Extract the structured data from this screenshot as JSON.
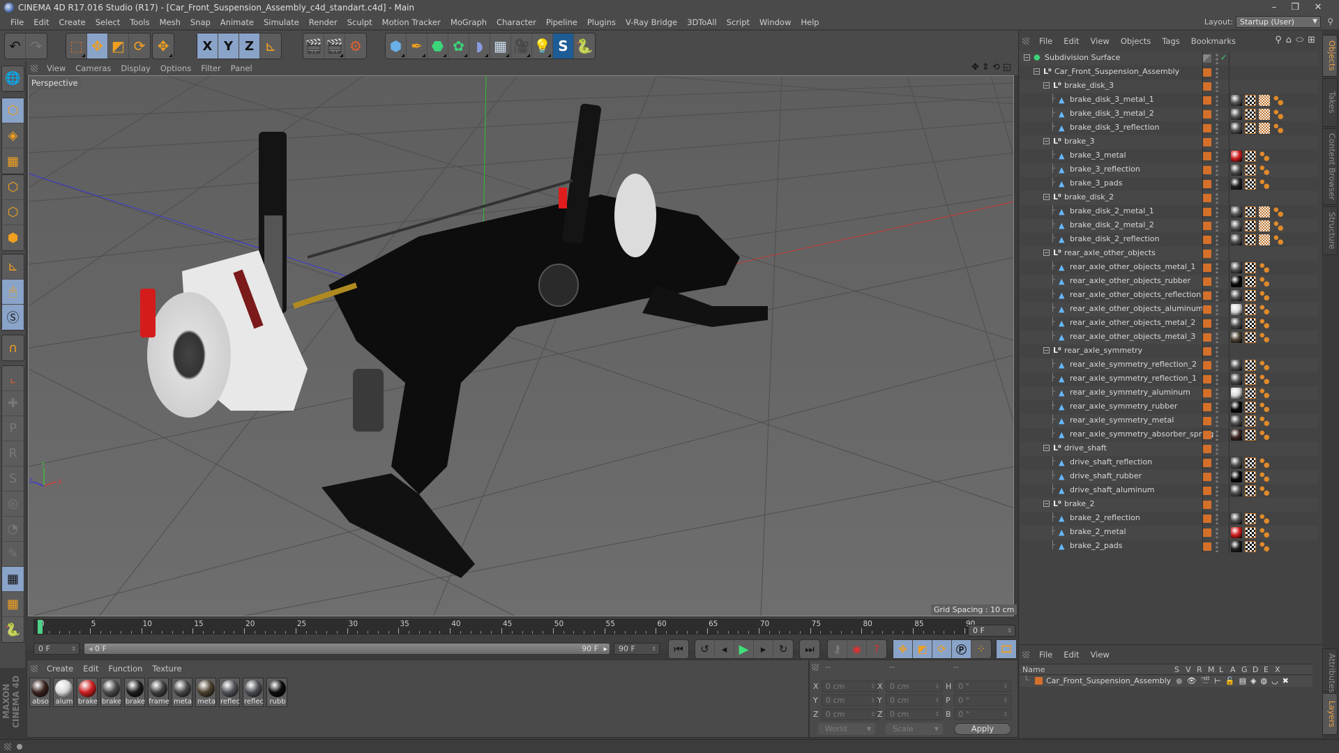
{
  "window": {
    "title": "CINEMA 4D R17.016 Studio (R17) - [Car_Front_Suspension_Assembly_c4d_standart.c4d] - Main",
    "controls": {
      "minimize": "–",
      "restore": "❐",
      "close": "✕"
    }
  },
  "menubar": [
    "File",
    "Edit",
    "Create",
    "Select",
    "Tools",
    "Mesh",
    "Snap",
    "Animate",
    "Simulate",
    "Render",
    "Sculpt",
    "Motion Tracker",
    "MoGraph",
    "Character",
    "Pipeline",
    "Plugins",
    "V-Ray Bridge",
    "3DToAll",
    "Script",
    "Window",
    "Help"
  ],
  "layout": {
    "label": "Layout:",
    "value": "Startup (User)"
  },
  "toolbar": {
    "undo": "undo-icon",
    "redo": "redo-icon",
    "tools": [
      "live-selection",
      "move",
      "scale",
      "rotate",
      "recent-tool"
    ],
    "axes": [
      "X",
      "Y",
      "Z"
    ],
    "coord_system": "world-coordinates-icon",
    "render": [
      "render-view",
      "render-to-picture-viewer",
      "render-settings"
    ],
    "objects": [
      "cube",
      "pen",
      "subdivision",
      "cloner",
      "deformer",
      "floor",
      "camera",
      "light",
      "vray",
      "python"
    ]
  },
  "viewport": {
    "menu": [
      "View",
      "Cameras",
      "Display",
      "Options",
      "Filter",
      "Panel"
    ],
    "camera_label": "Perspective",
    "grid_spacing": "Grid Spacing : 10 cm",
    "axis_labels": {
      "x": "X",
      "y": "Y",
      "z": "Z"
    }
  },
  "timeline": {
    "ticks": [
      0,
      5,
      10,
      15,
      20,
      25,
      30,
      35,
      40,
      45,
      50,
      55,
      60,
      65,
      70,
      75,
      80,
      85,
      90
    ],
    "current_frame": "0 F",
    "start_field": "0 F",
    "range_start": "0 F",
    "range_end": "90 F",
    "end_field": "90 F",
    "progress_fraction": 0
  },
  "material_panel": {
    "menu": [
      "Create",
      "Edit",
      "Function",
      "Texture"
    ],
    "materials": [
      {
        "label": "abso",
        "color": "#3a2420"
      },
      {
        "label": "alum",
        "color": "#d8d8d8"
      },
      {
        "label": "brake",
        "color": "#cc2020"
      },
      {
        "label": "brake",
        "color": "#4a4a4a"
      },
      {
        "label": "brake",
        "color": "#1e1e1e"
      },
      {
        "label": "frame",
        "color": "#3f3f3f"
      },
      {
        "label": "meta",
        "color": "#474747"
      },
      {
        "label": "meta",
        "color": "#4a3f2e"
      },
      {
        "label": "reflec",
        "color": "#505258"
      },
      {
        "label": "reflec",
        "color": "#4c4e54"
      },
      {
        "label": "rubb",
        "color": "#0c0c0c"
      }
    ],
    "branding": "MAXON CINEMA 4D"
  },
  "coordinates": {
    "headers": [
      "--",
      "--",
      "--"
    ],
    "rows": [
      {
        "l1": "X",
        "v1": "0 cm",
        "l2": "X",
        "v2": "0 cm",
        "l3": "H",
        "v3": "0 °"
      },
      {
        "l1": "Y",
        "v1": "0 cm",
        "l2": "Y",
        "v2": "0 cm",
        "l3": "P",
        "v3": "0 °"
      },
      {
        "l1": "Z",
        "v1": "0 cm",
        "l2": "Z",
        "v2": "0 cm",
        "l3": "B",
        "v3": "0 °"
      }
    ],
    "mode_dropdown": "World",
    "type_dropdown": "Scale",
    "apply_label": "Apply"
  },
  "object_manager": {
    "menu": [
      "File",
      "Edit",
      "View",
      "Objects",
      "Tags",
      "Bookmarks"
    ],
    "objects": [
      {
        "name": "Subdivision Surface",
        "depth": 0,
        "type": "subdivision",
        "tags": []
      },
      {
        "name": "Car_Front_Suspension_Assembly",
        "depth": 1,
        "type": "null",
        "tags": []
      },
      {
        "name": "brake_disk_3",
        "depth": 2,
        "type": "null",
        "tags": []
      },
      {
        "name": "brake_disk_3_metal_1",
        "depth": 3,
        "type": "mesh",
        "mat": "#555",
        "tags": [
          "mat",
          "tex",
          "uv",
          "pts"
        ]
      },
      {
        "name": "brake_disk_3_metal_2",
        "depth": 3,
        "type": "mesh",
        "mat": "#555",
        "tags": [
          "mat",
          "tex",
          "uv",
          "pts"
        ]
      },
      {
        "name": "brake_disk_3_reflection",
        "depth": 3,
        "type": "mesh",
        "mat": "#4f4f4f",
        "tags": [
          "mat",
          "tex",
          "uv",
          "pts"
        ]
      },
      {
        "name": "brake_3",
        "depth": 2,
        "type": "null",
        "tags": []
      },
      {
        "name": "brake_3_metal",
        "depth": 3,
        "type": "mesh",
        "mat": "#d01e1e",
        "tags": [
          "mat",
          "tex",
          "pts"
        ]
      },
      {
        "name": "brake_3_reflection",
        "depth": 3,
        "type": "mesh",
        "mat": "#4f4f4f",
        "tags": [
          "mat",
          "tex",
          "pts"
        ]
      },
      {
        "name": "brake_3_pads",
        "depth": 3,
        "type": "mesh",
        "mat": "#1f1f1f",
        "tags": [
          "mat",
          "tex",
          "pts"
        ]
      },
      {
        "name": "brake_disk_2",
        "depth": 2,
        "type": "null",
        "tags": []
      },
      {
        "name": "brake_disk_2_metal_1",
        "depth": 3,
        "type": "mesh",
        "mat": "#555",
        "tags": [
          "mat",
          "tex",
          "uv",
          "pts"
        ]
      },
      {
        "name": "brake_disk_2_metal_2",
        "depth": 3,
        "type": "mesh",
        "mat": "#555",
        "tags": [
          "mat",
          "tex",
          "uv",
          "pts"
        ]
      },
      {
        "name": "brake_disk_2_reflection",
        "depth": 3,
        "type": "mesh",
        "mat": "#4f4f4f",
        "tags": [
          "mat",
          "tex",
          "uv",
          "pts"
        ]
      },
      {
        "name": "rear_axle_other_objects",
        "depth": 2,
        "type": "null",
        "tags": []
      },
      {
        "name": "rear_axle_other_objects_metal_1",
        "depth": 3,
        "type": "mesh",
        "mat": "#4f4f4f",
        "tags": [
          "mat",
          "tex",
          "pts"
        ]
      },
      {
        "name": "rear_axle_other_objects_rubber",
        "depth": 3,
        "type": "mesh",
        "mat": "#0a0a0a",
        "tags": [
          "mat",
          "tex",
          "pts"
        ]
      },
      {
        "name": "rear_axle_other_objects_reflection",
        "depth": 3,
        "type": "mesh",
        "mat": "#4f4f4f",
        "tags": [
          "mat",
          "tex",
          "pts"
        ]
      },
      {
        "name": "rear_axle_other_objects_aluminum",
        "depth": 3,
        "type": "mesh",
        "mat": "#d8d8d8",
        "tags": [
          "mat",
          "tex",
          "pts"
        ]
      },
      {
        "name": "rear_axle_other_objects_metal_2",
        "depth": 3,
        "type": "mesh",
        "mat": "#4f4f4f",
        "tags": [
          "mat",
          "tex",
          "pts"
        ]
      },
      {
        "name": "rear_axle_other_objects_metal_3",
        "depth": 3,
        "type": "mesh",
        "mat": "#4a4030",
        "tags": [
          "mat",
          "tex",
          "pts"
        ]
      },
      {
        "name": "rear_axle_symmetry",
        "depth": 2,
        "type": "null",
        "tags": []
      },
      {
        "name": "rear_axle_symmetry_reflection_2",
        "depth": 3,
        "type": "mesh",
        "mat": "#4f4f4f",
        "tags": [
          "mat",
          "tex",
          "pts"
        ]
      },
      {
        "name": "rear_axle_symmetry_reflection_1",
        "depth": 3,
        "type": "mesh",
        "mat": "#4f4f4f",
        "tags": [
          "mat",
          "tex",
          "pts"
        ]
      },
      {
        "name": "rear_axle_symmetry_aluminum",
        "depth": 3,
        "type": "mesh",
        "mat": "#d8d8d8",
        "tags": [
          "mat",
          "tex",
          "pts"
        ]
      },
      {
        "name": "rear_axle_symmetry_rubber",
        "depth": 3,
        "type": "mesh",
        "mat": "#0a0a0a",
        "tags": [
          "mat",
          "tex",
          "pts"
        ]
      },
      {
        "name": "rear_axle_symmetry_metal",
        "depth": 3,
        "type": "mesh",
        "mat": "#4f4f4f",
        "tags": [
          "mat",
          "tex",
          "pts"
        ]
      },
      {
        "name": "rear_axle_symmetry_absorber_spring",
        "depth": 3,
        "type": "mesh",
        "mat": "#3a2420",
        "tags": [
          "mat",
          "tex",
          "pts"
        ]
      },
      {
        "name": "drive_shaft",
        "depth": 2,
        "type": "null",
        "tags": []
      },
      {
        "name": "drive_shaft_reflection",
        "depth": 3,
        "type": "mesh",
        "mat": "#4f4f4f",
        "tags": [
          "mat",
          "tex",
          "pts"
        ]
      },
      {
        "name": "drive_shaft_rubber",
        "depth": 3,
        "type": "mesh",
        "mat": "#0a0a0a",
        "tags": [
          "mat",
          "tex",
          "pts"
        ]
      },
      {
        "name": "drive_shaft_aluminum",
        "depth": 3,
        "type": "mesh",
        "mat": "#4f4f4f",
        "tags": [
          "mat",
          "tex",
          "pts"
        ]
      },
      {
        "name": "brake_2",
        "depth": 2,
        "type": "null",
        "tags": []
      },
      {
        "name": "brake_2_reflection",
        "depth": 3,
        "type": "mesh",
        "mat": "#4f4f4f",
        "tags": [
          "mat",
          "tex",
          "pts"
        ]
      },
      {
        "name": "brake_2_metal",
        "depth": 3,
        "type": "mesh",
        "mat": "#d01e1e",
        "tags": [
          "mat",
          "tex",
          "pts"
        ]
      },
      {
        "name": "brake_2_pads",
        "depth": 3,
        "type": "mesh",
        "mat": "#1f1f1f",
        "tags": [
          "mat",
          "tex",
          "pts"
        ]
      }
    ]
  },
  "right_tabs_top": [
    {
      "label": "Objects",
      "active": true
    },
    {
      "label": "Takes",
      "active": false
    },
    {
      "label": "Content Browser",
      "active": false
    },
    {
      "label": "Structure",
      "active": false
    }
  ],
  "right_tabs_bottom": [
    {
      "label": "Attributes",
      "active": false
    },
    {
      "label": "Layers",
      "active": true
    }
  ],
  "layer_manager": {
    "menu": [
      "File",
      "Edit",
      "View"
    ],
    "columns": [
      "Name",
      "S",
      "V",
      "R",
      "M",
      "L",
      "A",
      "G",
      "D",
      "E",
      "X"
    ],
    "rows": [
      {
        "name": "Car_Front_Suspension_Assembly",
        "color": "#d4702a"
      }
    ]
  },
  "colors": {
    "accent_orange": "#d4702a",
    "selected_blue": "#8aa3c8",
    "play_green": "#4fd18a"
  }
}
